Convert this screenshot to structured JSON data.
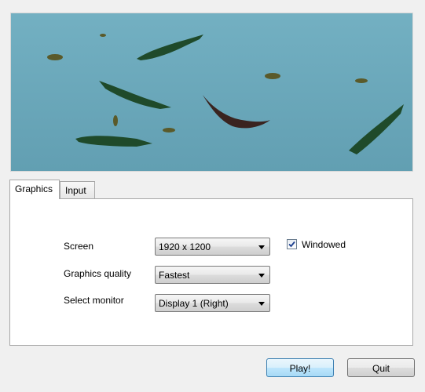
{
  "banner": {
    "image": "swimming-crocodiles-illustration"
  },
  "tabs": [
    {
      "label": "Graphics",
      "active": true
    },
    {
      "label": "Input",
      "active": false
    }
  ],
  "settings": {
    "screen": {
      "label": "Screen",
      "value": "1920 x 1200"
    },
    "quality": {
      "label": "Graphics quality",
      "value": "Fastest"
    },
    "monitor": {
      "label": "Select monitor",
      "value": "Display 1 (Right)"
    },
    "windowed": {
      "label": "Windowed",
      "checked": true
    }
  },
  "buttons": {
    "play": "Play!",
    "quit": "Quit"
  },
  "icons": {
    "dropdown": "chevron-down-icon",
    "check": "checkmark-icon"
  },
  "colors": {
    "water": "#6aa9bb",
    "crocodile": "#1f4a2a",
    "otter": "#3a2420"
  }
}
